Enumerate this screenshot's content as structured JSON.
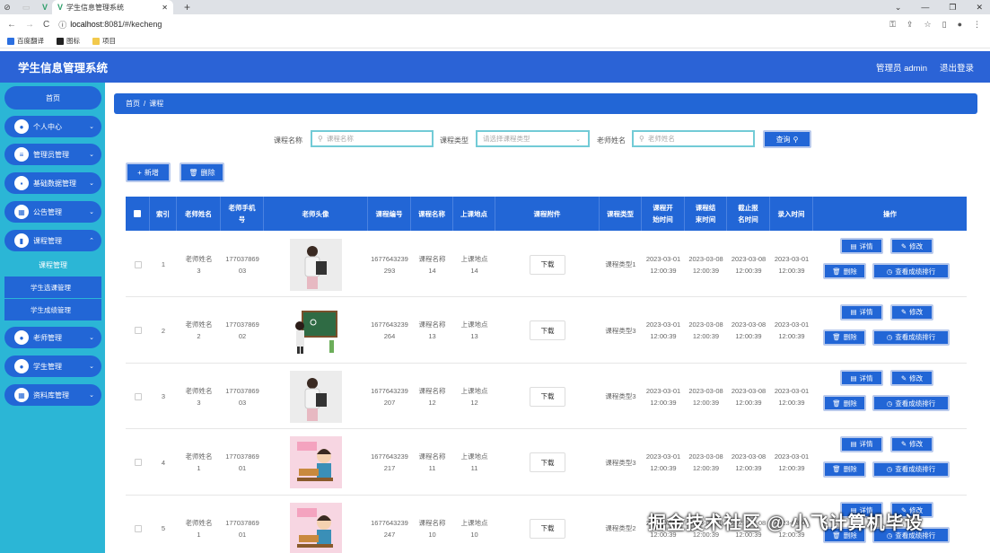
{
  "browser": {
    "tab_title": "学生信息管理系统",
    "url_host": "localhost",
    "url_rest": ":8081/#/kecheng",
    "bookmarks": [
      "百度翻译",
      "图标",
      "项目"
    ]
  },
  "header": {
    "title": "学生信息管理系统",
    "user": "管理员 admin",
    "logout": "退出登录"
  },
  "sidebar": {
    "home": "首页",
    "items": [
      {
        "label": "个人中心",
        "icon": "user-icon"
      },
      {
        "label": "管理员管理",
        "icon": "list-icon"
      },
      {
        "label": "基础数据管理",
        "icon": "data-icon"
      },
      {
        "label": "公告管理",
        "icon": "grid-icon"
      },
      {
        "label": "课程管理",
        "icon": "chart-icon"
      }
    ],
    "submenu": [
      "课程管理",
      "学生选课管理",
      "学生成绩管理"
    ],
    "items_after": [
      {
        "label": "老师管理",
        "icon": "teacher-icon"
      },
      {
        "label": "学生管理",
        "icon": "student-icon"
      },
      {
        "label": "资料库管理",
        "icon": "library-icon"
      }
    ]
  },
  "breadcrumb": {
    "home": "首页",
    "sep": "/",
    "current": "课程"
  },
  "search": {
    "course_name_label": "课程名称",
    "course_name_placeholder": "课程名称",
    "course_type_label": "课程类型",
    "course_type_placeholder": "请选择课程类型",
    "teacher_label": "老师姓名",
    "teacher_placeholder": "老师姓名",
    "query_button": "查询"
  },
  "toolbar": {
    "add": "新增",
    "delete": "删除"
  },
  "table": {
    "headers": [
      "",
      "索引",
      "老师姓名",
      "老师手机号",
      "老师头像",
      "课程编号",
      "课程名称",
      "上课地点",
      "课程附件",
      "课程类型",
      "课程开始时间",
      "课程结束时间",
      "截止报名时间",
      "录入时间",
      "操作"
    ],
    "download_label": "下载",
    "actions": {
      "detail": "详情",
      "edit": "修改",
      "delete": "删除",
      "rank": "查看成绩排行"
    },
    "rows": [
      {
        "index": "1",
        "teacher": "老师姓名3",
        "phone": "17703786903",
        "avatar": "teacher-photo",
        "code": "1677643239293",
        "name": "课程名称14",
        "place": "上课地点14",
        "type": "课程类型1",
        "start": "2023-03-01 12:00:39",
        "end": "2023-03-08 12:00:39",
        "deadline": "2023-03-08 12:00:39",
        "created": "2023-03-01 12:00:39"
      },
      {
        "index": "2",
        "teacher": "老师姓名2",
        "phone": "17703786902",
        "avatar": "blackboard-teacher",
        "code": "1677643239264",
        "name": "课程名称13",
        "place": "上课地点13",
        "type": "课程类型3",
        "start": "2023-03-01 12:00:39",
        "end": "2023-03-08 12:00:39",
        "deadline": "2023-03-08 12:00:39",
        "created": "2023-03-01 12:00:39"
      },
      {
        "index": "3",
        "teacher": "老师姓名3",
        "phone": "17703786903",
        "avatar": "teacher-photo",
        "code": "1677643239207",
        "name": "课程名称12",
        "place": "上课地点12",
        "type": "课程类型3",
        "start": "2023-03-01 12:00:39",
        "end": "2023-03-08 12:00:39",
        "deadline": "2023-03-08 12:00:39",
        "created": "2023-03-01 12:00:39"
      },
      {
        "index": "4",
        "teacher": "老师姓名1",
        "phone": "17703786901",
        "avatar": "cartoon-teacher",
        "code": "1677643239217",
        "name": "课程名称11",
        "place": "上课地点11",
        "type": "课程类型3",
        "start": "2023-03-01 12:00:39",
        "end": "2023-03-08 12:00:39",
        "deadline": "2023-03-08 12:00:39",
        "created": "2023-03-01 12:00:39"
      },
      {
        "index": "5",
        "teacher": "老师姓名1",
        "phone": "17703786901",
        "avatar": "cartoon-teacher",
        "code": "1677643239247",
        "name": "课程名称10",
        "place": "上课地点10",
        "type": "课程类型2",
        "start": "2023-03-01 12:00:39",
        "end": "2023-03-08 12:00:39",
        "deadline": "2023-03-08 12:00:39",
        "created": "2023-03-01 12:00:39"
      }
    ]
  },
  "watermark": "掘金技术社区 @ 小飞计算机毕设",
  "colors": {
    "primary": "#2266d6",
    "sidebar": "#2bb6d6",
    "header": "#2b63d6",
    "input_border": "#72cbd6"
  }
}
